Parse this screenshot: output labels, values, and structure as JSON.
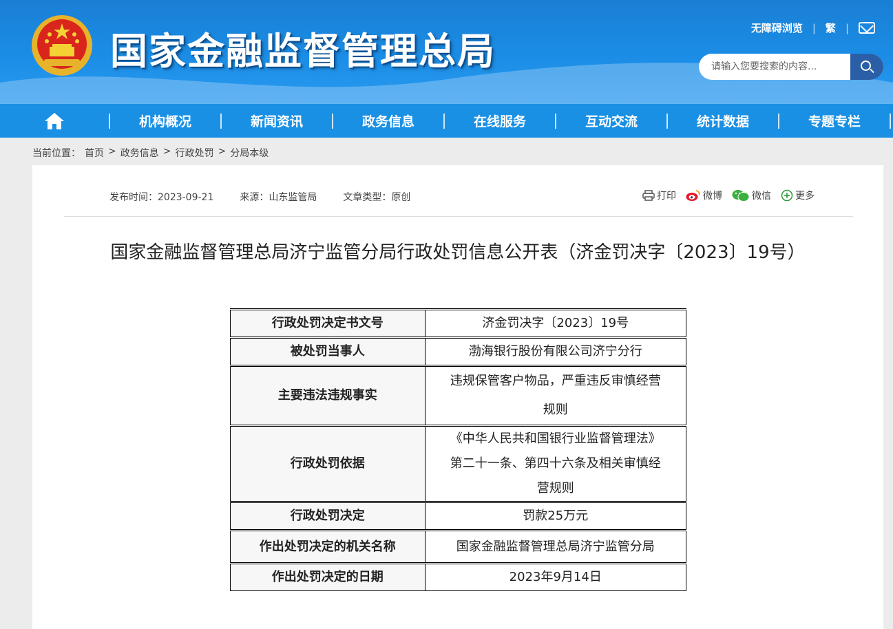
{
  "header": {
    "site_title": "国家金融监督管理总局",
    "accessibility": "无障碍浏览",
    "traditional": "繁",
    "search_placeholder": "请输入您要搜索的内容...",
    "colors": {
      "header_blue": "#1b8de6",
      "nav_blue": "#1a90e4",
      "search_button": "#2a5fa8"
    }
  },
  "nav": {
    "items": [
      "机构概况",
      "新闻资讯",
      "政务信息",
      "在线服务",
      "互动交流",
      "统计数据",
      "专题专栏"
    ]
  },
  "breadcrumb": {
    "label": "当前位置：",
    "items": [
      "首页",
      "政务信息",
      "行政处罚",
      "分局本级"
    ],
    "sep": ">"
  },
  "meta": {
    "publish_time": "发布时间：2023-09-21",
    "source": "来源：山东监管局",
    "type": "文章类型：原创"
  },
  "share": {
    "print": "打印",
    "weibo": "微博",
    "wechat": "微信",
    "more": "更多"
  },
  "article": {
    "title": "国家金融监督管理总局济宁监管分局行政处罚信息公开表（济金罚决字〔2023〕19号）"
  },
  "table": {
    "rows": [
      {
        "key": "行政处罚决定书文号",
        "value": "济金罚决字〔2023〕19号"
      },
      {
        "key": "被处罚当事人",
        "value": "渤海银行股份有限公司济宁分行"
      },
      {
        "key": "主要违法违规事实",
        "value_lines": [
          "违规保管客户物品，严重违反审慎经营",
          "规则"
        ]
      },
      {
        "key": "行政处罚依据",
        "value_lines": [
          "《中华人民共和国银行业监督管理法》",
          "第二十一条、第四十六条及相关审慎经",
          "营规则"
        ]
      },
      {
        "key": "行政处罚决定",
        "value": "罚款25万元"
      },
      {
        "key": "作出处罚决定的机关名称",
        "value": "国家金融监督管理总局济宁监管分局"
      },
      {
        "key": "作出处罚决定的日期",
        "value": "2023年9月14日"
      }
    ]
  }
}
